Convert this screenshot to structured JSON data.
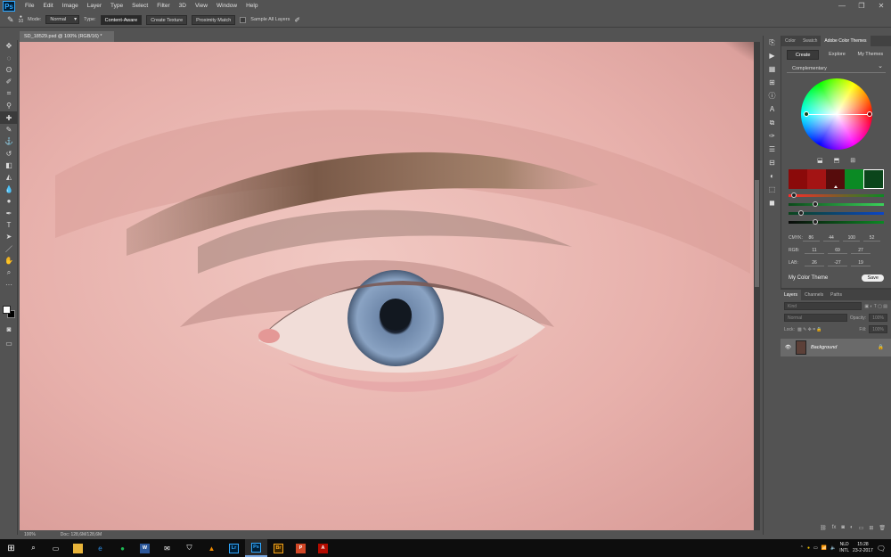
{
  "app": {
    "logo": "Ps"
  },
  "menu": [
    "File",
    "Edit",
    "Image",
    "Layer",
    "Type",
    "Select",
    "Filter",
    "3D",
    "View",
    "Window",
    "Help"
  ],
  "window_controls": [
    "—",
    "❐",
    "✕"
  ],
  "options": {
    "brush_size": "10",
    "mode_label": "Mode:",
    "mode_value": "Normal",
    "type_label": "Type:",
    "btn_content_aware": "Content-Aware",
    "btn_create_texture": "Create Texture",
    "btn_proximity_match": "Proximity Match",
    "sample_all_layers": "Sample All Layers"
  },
  "document": {
    "tab_title": "SD_18529.psd @ 100% (RGB/16) *",
    "zoom": "100%",
    "doc_info": "Doc: 128,6M/128,6M"
  },
  "color_panel": {
    "tabs": [
      "Color",
      "Swatch",
      "Adobe Color Themes"
    ],
    "subtabs": [
      "Create",
      "Explore",
      "My Themes"
    ],
    "rule": "Complementary",
    "swatches": [
      "#8b0a0a",
      "#a31414",
      "#560c0c",
      "#0b8a24",
      "#0b451b"
    ],
    "sliders": [
      {
        "color": "linear-gradient(90deg,#ff2a2a,#0b8a24)",
        "value": 0.04
      },
      {
        "color": "linear-gradient(90deg,#0b4a1a,#3ad35a)",
        "value": 0.27
      },
      {
        "color": "linear-gradient(90deg,#0b451b,#0b45c9)",
        "value": 0.12
      },
      {
        "color": "linear-gradient(90deg,#0a0a0a,#0b8a24)",
        "value": 0.27
      }
    ],
    "values": [
      {
        "label": "CMYK:",
        "vals": [
          "86",
          "44",
          "100",
          "52"
        ]
      },
      {
        "label": "RGB:",
        "vals": [
          "11",
          "69",
          "27"
        ]
      },
      {
        "label": "LAB:",
        "vals": [
          "26",
          "-27",
          "19"
        ]
      }
    ],
    "theme_name": "My Color Theme",
    "save_label": "Save"
  },
  "layers_panel": {
    "tabs": [
      "Layers",
      "Channels",
      "Paths"
    ],
    "kind_placeholder": "Kind",
    "blend_mode": "Normal",
    "opacity_label": "Opacity:",
    "opacity_value": "100%",
    "lock_label": "Lock:",
    "fill_label": "Fill:",
    "fill_value": "100%",
    "layer_name": "Background"
  },
  "taskbar": {
    "lang": "NLD",
    "layout": "INTL",
    "time": "15:28",
    "date": "23-2-2017"
  }
}
